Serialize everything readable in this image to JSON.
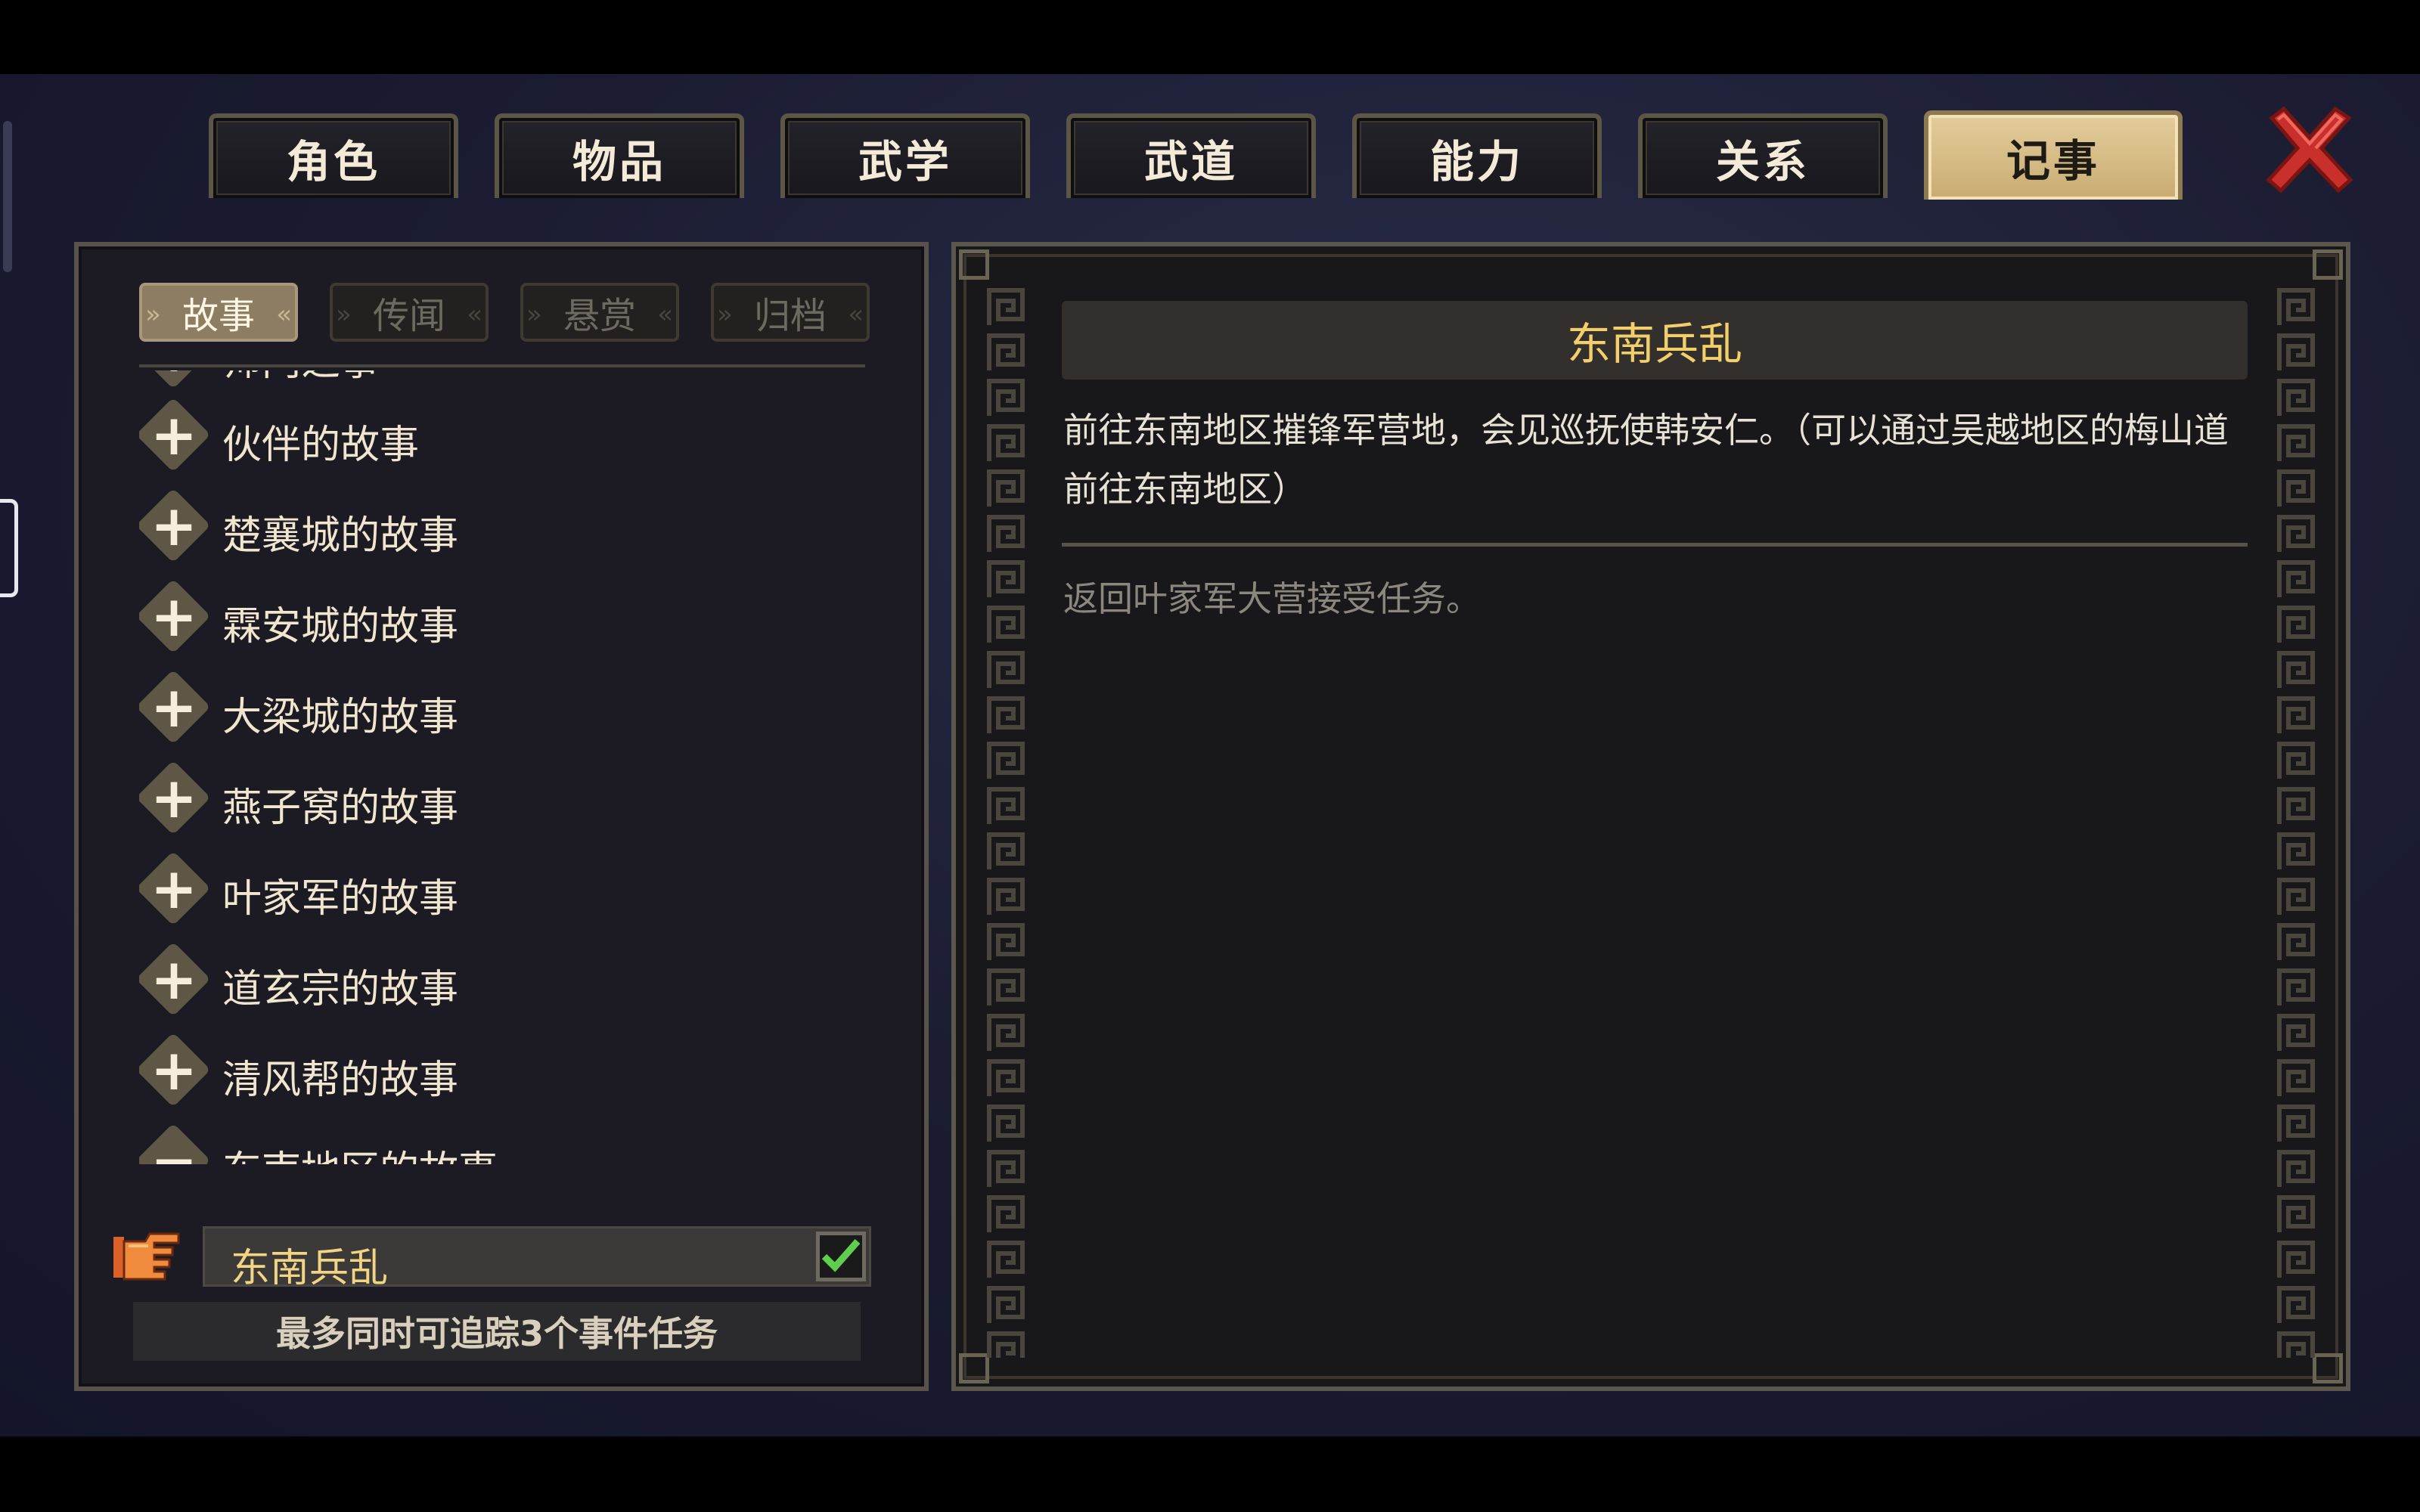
{
  "tabs": [
    {
      "label": "角色"
    },
    {
      "label": "物品"
    },
    {
      "label": "武学"
    },
    {
      "label": "武道"
    },
    {
      "label": "能力"
    },
    {
      "label": "关系"
    },
    {
      "label": "记事"
    }
  ],
  "active_tab": "记事",
  "close_icon": "close-x-icon",
  "subtabs": [
    {
      "label": "故事"
    },
    {
      "label": "传闻"
    },
    {
      "label": "悬赏"
    },
    {
      "label": "归档"
    }
  ],
  "active_subtab": "故事",
  "story_list": {
    "partial_item": "师门之事",
    "items": [
      {
        "label": "伙伴的故事",
        "state": "collapsed"
      },
      {
        "label": "楚襄城的故事",
        "state": "collapsed"
      },
      {
        "label": "霖安城的故事",
        "state": "collapsed"
      },
      {
        "label": "大梁城的故事",
        "state": "collapsed"
      },
      {
        "label": "燕子窝的故事",
        "state": "collapsed"
      },
      {
        "label": "叶家军的故事",
        "state": "collapsed"
      },
      {
        "label": "道玄宗的故事",
        "state": "collapsed"
      },
      {
        "label": "清风帮的故事",
        "state": "collapsed"
      },
      {
        "label": "东南地区的故事",
        "state": "expanded"
      }
    ],
    "selected_quest": {
      "label": "东南兵乱",
      "tracked": true
    }
  },
  "track_hint": "最多同时可追踪3个事件任务",
  "detail": {
    "title": "东南兵乱",
    "description": "前往东南地区摧锋军营地，会见巡抚使韩安仁。（可以通过吴越地区的梅山道前往东南地区）",
    "step": "返回叶家军大营接受任务。"
  },
  "colors": {
    "accent_gold": "#f2cf6a",
    "active_tab": "#d9c08a",
    "close_red": "#d8352e",
    "check_green": "#5fce4e"
  }
}
